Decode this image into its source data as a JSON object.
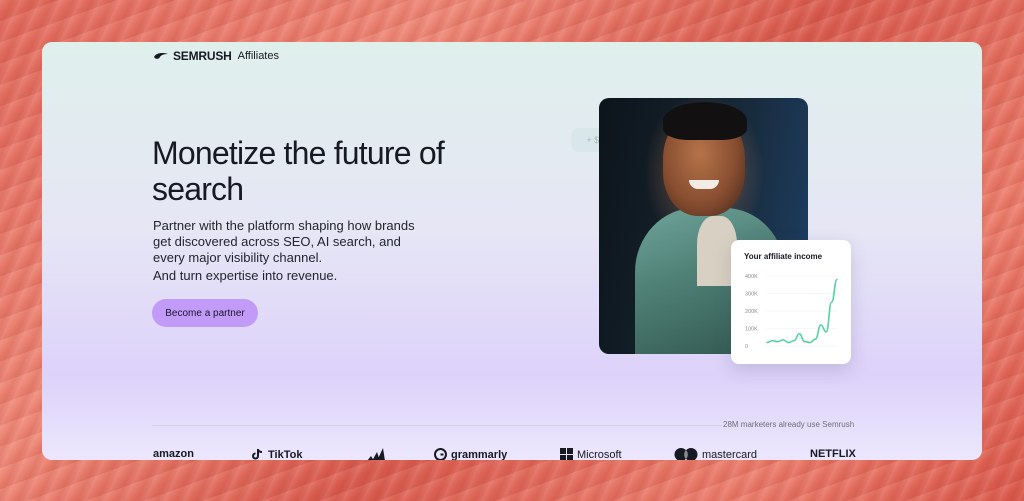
{
  "brand": {
    "name": "SEMRUSH",
    "sub": "Affiliates"
  },
  "hero": {
    "headline": "Monetize the future of search",
    "description": "Partner with the platform shaping how brands get discovered across SEO, AI search, and every major visibility channel.",
    "description2": "And turn expertise into revenue.",
    "cta_label": "Become a partner"
  },
  "ghost_chip": "+ $ 00",
  "income_card": {
    "title": "Your affiliate income",
    "y_ticks": [
      "400K",
      "300K",
      "200K",
      "100K",
      "0"
    ]
  },
  "chart_data": {
    "type": "line",
    "title": "Your affiliate income",
    "yticks": [
      "400K",
      "300K",
      "200K",
      "100K",
      "0"
    ],
    "ylim": [
      0,
      400000
    ],
    "values": [
      20000,
      30000,
      25000,
      35000,
      20000,
      30000,
      70000,
      25000,
      20000,
      40000,
      120000,
      80000,
      250000,
      380000
    ],
    "color": "#52d39f"
  },
  "social_proof": {
    "text": "28M marketers already use Semrush"
  },
  "logos": [
    {
      "name": "amazon",
      "label": "amazon"
    },
    {
      "name": "tiktok",
      "label": "TikTok"
    },
    {
      "name": "adidas",
      "label": ""
    },
    {
      "name": "grammarly",
      "label": "grammarly"
    },
    {
      "name": "microsoft",
      "label": "Microsoft"
    },
    {
      "name": "mastercard",
      "label": "mastercard"
    },
    {
      "name": "netflix",
      "label": "NETFLIX"
    }
  ],
  "colors": {
    "accent": "#c29bf8",
    "chart_line": "#52d39f",
    "text": "#171a22"
  }
}
